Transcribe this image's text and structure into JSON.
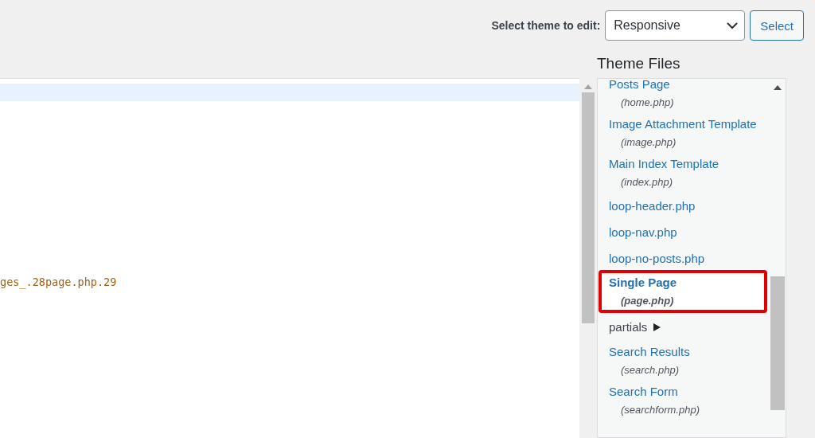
{
  "theme_select": {
    "label": "Select theme to edit:",
    "value": "Responsive",
    "button": "Select"
  },
  "sidebar": {
    "title": "Theme Files",
    "items": [
      {
        "kind": "file",
        "name": "Posts Page",
        "file": "(home.php)",
        "selected": false
      },
      {
        "kind": "file",
        "name": "Image Attachment Template",
        "file": "(image.php)",
        "selected": false
      },
      {
        "kind": "file",
        "name": "Main Index Template",
        "file": "(index.php)",
        "selected": false
      },
      {
        "kind": "file",
        "name": "loop-header.php",
        "selected": false
      },
      {
        "kind": "file",
        "name": "loop-nav.php",
        "selected": false
      },
      {
        "kind": "file",
        "name": "loop-no-posts.php",
        "selected": false
      },
      {
        "kind": "file",
        "name": "Single Page",
        "file": "(page.php)",
        "selected": true
      },
      {
        "kind": "folder",
        "name": "partials",
        "expanded": false
      },
      {
        "kind": "file",
        "name": "Search Results",
        "file": "(search.php)",
        "selected": false
      },
      {
        "kind": "file",
        "name": "Search Form",
        "file": "(searchform.php)",
        "selected": false
      }
    ]
  },
  "editor": {
    "lines": [
      {
        "highlighted": true
      },
      {
        "text": "ges_.28page.php.29",
        "highlighted": false
      }
    ]
  }
}
